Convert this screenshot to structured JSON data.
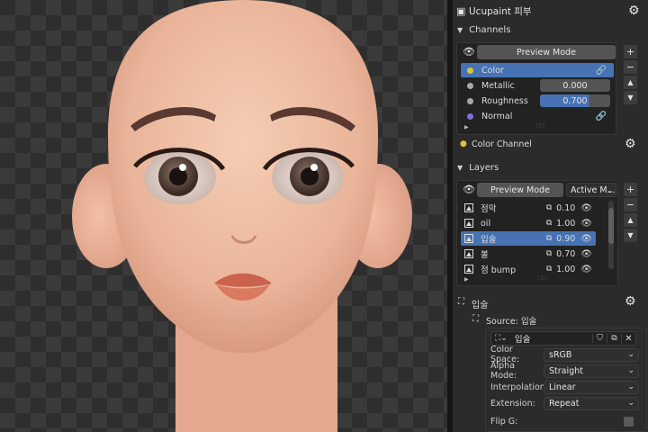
{
  "viewport": {
    "description_free": true
  },
  "header": {
    "title": "Ucupaint 피부",
    "settings_icon": "gear-icon"
  },
  "channels": {
    "section_label": "Channels",
    "preview_mode": "Preview Mode",
    "items": [
      {
        "name": "Color",
        "dot": "#d4c83a",
        "value": "",
        "selected": true,
        "linked": true
      },
      {
        "name": "Metallic",
        "dot": "#a8a8a8",
        "value": "0.000",
        "selected": false,
        "fraction": 0.0
      },
      {
        "name": "Roughness",
        "dot": "#a8a8a8",
        "value": "0.700",
        "selected": false,
        "fraction": 0.7
      },
      {
        "name": "Normal",
        "dot": "#7a6fd6",
        "value": "",
        "selected": false,
        "linked": true
      }
    ],
    "active_channel_label": "Color Channel"
  },
  "layers": {
    "section_label": "Layers",
    "preview_mode": "Preview Mode",
    "active_mode": "Active M...",
    "items": [
      {
        "name": "점막",
        "opacity": "0.10",
        "selected": false
      },
      {
        "name": "oil",
        "opacity": "1.00",
        "selected": false
      },
      {
        "name": "입술",
        "opacity": "0.90",
        "selected": true
      },
      {
        "name": "볼",
        "opacity": "0.70",
        "selected": false
      },
      {
        "name": "점 bump",
        "opacity": "1.00",
        "selected": false
      }
    ]
  },
  "layer_detail": {
    "title": "입술",
    "source_label": "Source: 입술",
    "image_name": "입술",
    "props": [
      {
        "label": "Color Space:",
        "value": "sRGB"
      },
      {
        "label": "Alpha Mode:",
        "value": "Straight"
      },
      {
        "label": "Interpolation:",
        "value": "Linear"
      },
      {
        "label": "Extension:",
        "value": "Repeat"
      }
    ],
    "flip_label": "Flip G:"
  },
  "colors": {
    "accent": "#4772b3",
    "panel": "#2b2b2b",
    "box": "#222222"
  }
}
